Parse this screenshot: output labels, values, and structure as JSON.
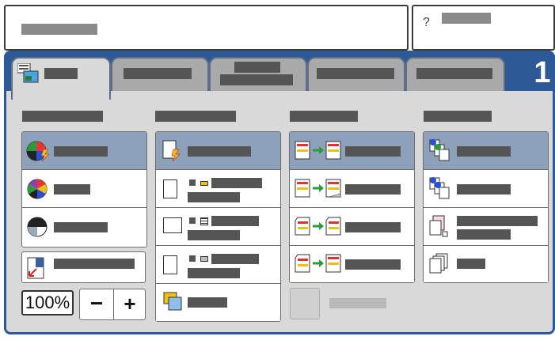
{
  "zoom": {
    "value": "100%",
    "decrease_label": "−",
    "increase_label": "+"
  },
  "help_icon": "?",
  "tab_count": "1",
  "icons": {
    "tab_main": "copy-tab-icon",
    "color_auto": "auto-color-icon",
    "color_full": "full-color-icon",
    "color_bw": "black-white-icon",
    "reduce": "reduce-enlarge-icon",
    "paper_auto": "paper-auto-icon",
    "sided_1": "one-sided-icon",
    "collate": "collated-icon",
    "preset": "presets-icon"
  },
  "colors": {
    "accent": "#2d5a96",
    "selected": "#8ea1bb",
    "tab_active": "#d9d9d9",
    "tab_inactive": "#a9a9a9"
  }
}
